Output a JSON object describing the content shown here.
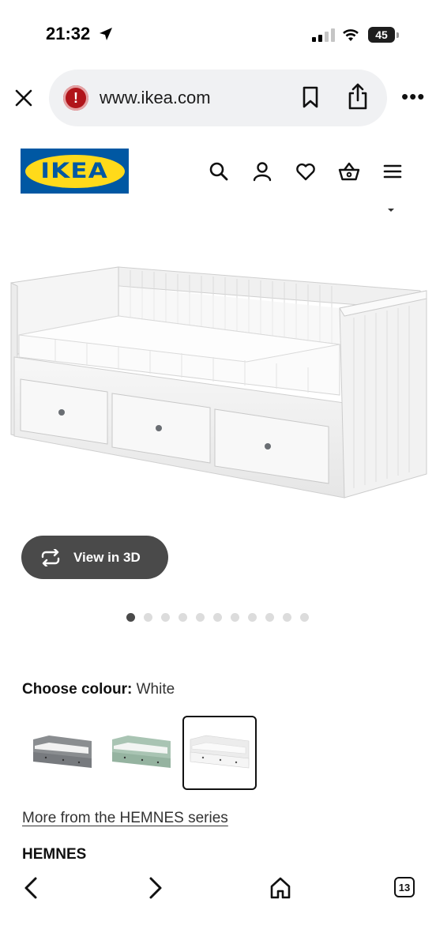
{
  "status_bar": {
    "time": "21:32",
    "battery": "45"
  },
  "browser": {
    "url": "www.ikea.com",
    "tabs_count": "13"
  },
  "ikea_header": {
    "logo_text": "IKEA"
  },
  "product": {
    "view_3d_label": "View in 3D",
    "gallery": {
      "total_images": 11,
      "active_index": 0
    },
    "colour_label": "Choose colour:",
    "colour_value": "White",
    "colour_options": [
      {
        "name": "Grey",
        "color": "#8a8d90"
      },
      {
        "name": "Green",
        "color": "#a9c4b3"
      },
      {
        "name": "White",
        "color": "#f2f2f2",
        "selected": true
      }
    ],
    "series_link": "More from the HEMNES series",
    "name": "HEMNES"
  },
  "colors": {
    "ikea_blue": "#0058a3",
    "ikea_yellow": "#ffda1a",
    "button_dark": "#4a4a4a",
    "alert_red": "#b1141a"
  }
}
